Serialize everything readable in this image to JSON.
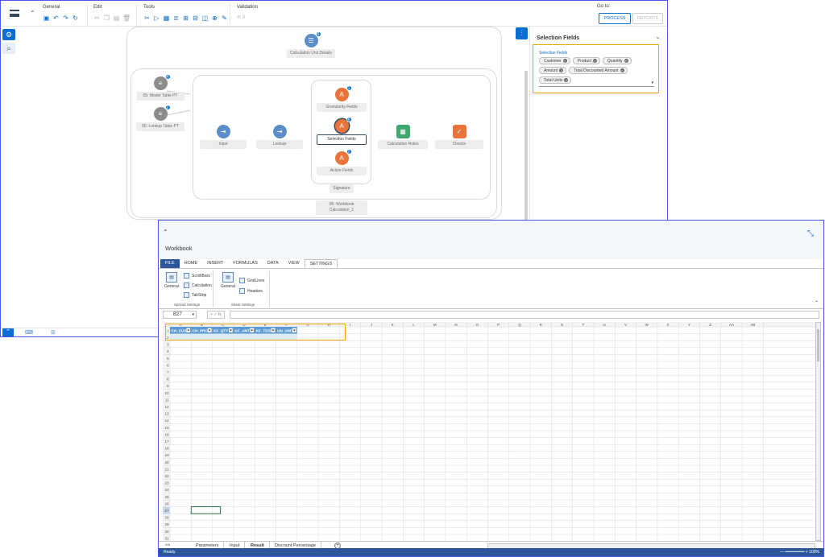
{
  "toolbar": {
    "groups": [
      {
        "label": "General"
      },
      {
        "label": "Edit"
      },
      {
        "label": "Tools"
      },
      {
        "label": "Validation"
      }
    ],
    "validation_count": "0",
    "goto_label": "Go to:",
    "process_label": "PROCESS",
    "reports_label": "REPORTS"
  },
  "canvas": {
    "nodes": [
      {
        "label": "Calculation Unit Details",
        "badge": "4"
      },
      {
        "label": "05: Model Table PT",
        "badge": "4"
      },
      {
        "label": "05: Lookup Table PT",
        "badge": "2"
      },
      {
        "label": "Input"
      },
      {
        "label": "Lookup"
      },
      {
        "label": "Granularity Fields",
        "badge": "1"
      },
      {
        "label": "Selection Fields",
        "badge": "6"
      },
      {
        "label": "Action Fields",
        "badge": "1"
      },
      {
        "label": "Calculation Rules"
      },
      {
        "label": "Checks"
      },
      {
        "label": "Signature"
      },
      {
        "label": "05: Workbook Calculation_1"
      }
    ]
  },
  "right_panel": {
    "title": "Selection Fields",
    "field_label": "Selection Fields",
    "tokens": [
      "Customer",
      "Product",
      "Quantity",
      "Amount",
      "Total Discounted Amount",
      "Total Units"
    ]
  },
  "workbook": {
    "title": "Workbook",
    "ribbon_tabs": [
      "FILE",
      "HOME",
      "INSERT",
      "FORMULAS",
      "DATA",
      "VIEW",
      "SETTINGS"
    ],
    "spread_settings": {
      "group_label": "Spread Settings",
      "general": "General",
      "items": [
        "ScrollBars",
        "Calculation",
        "TabStrip"
      ]
    },
    "sheet_settings": {
      "group_label": "Sheet Settings",
      "general": "General",
      "items": [
        "GridLines",
        "Headers"
      ]
    },
    "name_box": "B27",
    "fx_icons": "× ✓ fx",
    "columns": [
      "A",
      "B",
      "C",
      "D",
      "E",
      "F",
      "G",
      "H",
      "I",
      "J",
      "K",
      "L",
      "M",
      "N",
      "O",
      "P",
      "Q",
      "R",
      "S",
      "T",
      "U",
      "V",
      "W",
      "X",
      "Y",
      "Z",
      "AA",
      "AB"
    ],
    "header_cells": [
      "CH_CUST",
      "CH_PROD",
      "KF_QTY",
      "KF_AMT",
      "KF_TDISC",
      "UN_UNITS"
    ],
    "active_row": 27,
    "sheet_tabs": [
      "Parameters",
      "Input",
      "Result",
      "Discount Percentage"
    ],
    "active_sheet": "Result",
    "status": "Ready",
    "zoom": "100%"
  }
}
